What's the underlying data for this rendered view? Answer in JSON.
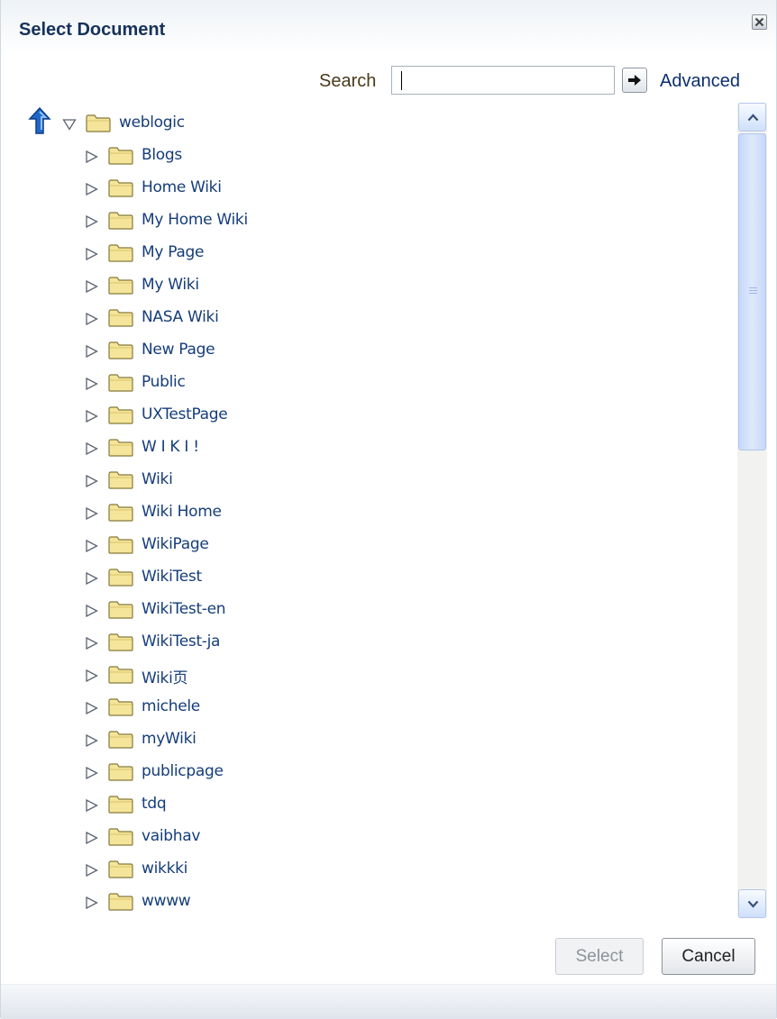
{
  "dialog": {
    "title": "Select Document",
    "close_icon": "close-icon"
  },
  "search": {
    "label": "Search",
    "value": "",
    "go_icon": "arrow-right-icon",
    "advanced_label": "Advanced"
  },
  "tree": {
    "up_icon": "up-arrow-icon",
    "root": {
      "label": "weblogic",
      "expanded": true
    },
    "children": [
      "Blogs",
      "Home Wiki",
      "My Home Wiki",
      "My Page",
      "My Wiki",
      "NASA Wiki",
      "New Page",
      "Public",
      "UXTestPage",
      "W I K I !",
      "Wiki",
      "Wiki Home",
      "WikiPage",
      "WikiTest",
      "WikiTest-en",
      "WikiTest-ja",
      "Wiki页",
      "michele",
      "myWiki",
      "publicpage",
      "tdq",
      "vaibhav",
      "wikkki",
      "wwww"
    ]
  },
  "buttons": {
    "select": "Select",
    "select_enabled": false,
    "cancel": "Cancel"
  },
  "colors": {
    "title": "#16325a",
    "link": "#153d7a",
    "folder_fill": "#f5e59a",
    "scroll_thumb": "#c6d7f8",
    "up_arrow": "#1f68c8"
  }
}
